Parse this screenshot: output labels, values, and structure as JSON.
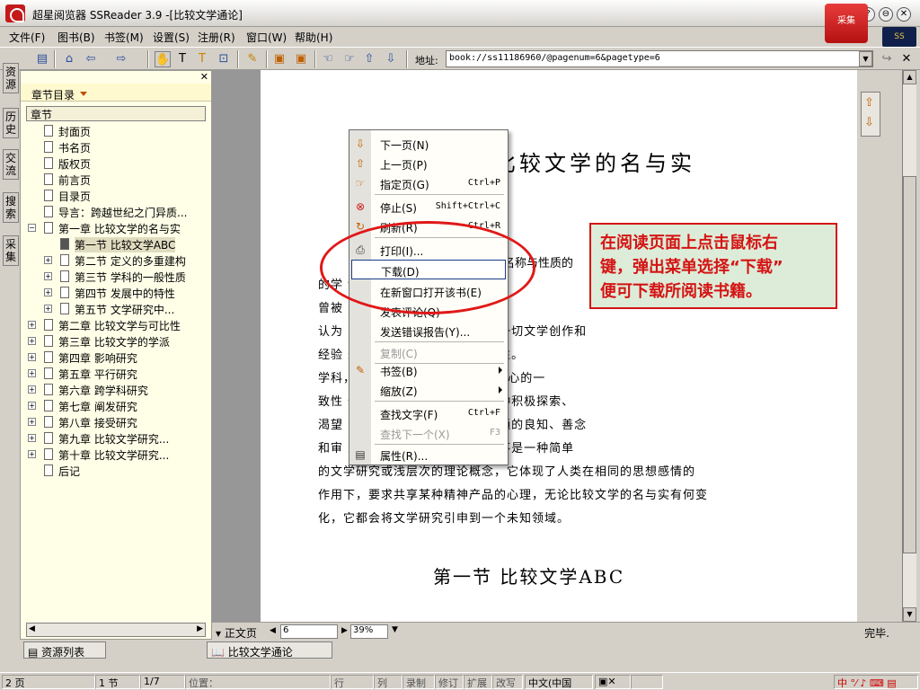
{
  "window": {
    "title": "超星阅览器 SSReader 3.9 -[比较文学通论]",
    "emblem": "采集"
  },
  "menu": [
    "文件(F)",
    "图书(B)",
    "书签(M)",
    "设置(S)",
    "注册(R)",
    "窗口(W)",
    "帮助(H)"
  ],
  "globe_logo": "SS",
  "toolbar": {
    "address_label": "地址:",
    "address_value": "book://ss11186960/@pagenum=6&pagetype=6"
  },
  "left_tabs": [
    "资源",
    "历史",
    "交流",
    "搜索",
    "采集"
  ],
  "sidebar": {
    "title": "章节目录",
    "column": "章节",
    "items": [
      {
        "label": "封面页",
        "level": 0,
        "expandable": false
      },
      {
        "label": "书名页",
        "level": 0,
        "expandable": false
      },
      {
        "label": "版权页",
        "level": 0,
        "expandable": false
      },
      {
        "label": "前言页",
        "level": 0,
        "expandable": false
      },
      {
        "label": "目录页",
        "level": 0,
        "expandable": false
      },
      {
        "label": "导言：跨越世纪之门异质...",
        "level": 0,
        "expandable": false
      },
      {
        "label": "第一章  比较文学的名与实",
        "level": 0,
        "expandable": true
      },
      {
        "label": "第一节  比较文学ABC",
        "level": 1,
        "expandable": false,
        "selected": true
      },
      {
        "label": "第二节  定义的多重建构",
        "level": 1,
        "expandable": true
      },
      {
        "label": "第三节  学科的一般性质",
        "level": 1,
        "expandable": true
      },
      {
        "label": "第四节  发展中的特性",
        "level": 1,
        "expandable": true
      },
      {
        "label": "第五节  文学研究中...",
        "level": 1,
        "expandable": true
      },
      {
        "label": "第二章  比较文学与可比性",
        "level": 0,
        "expandable": true
      },
      {
        "label": "第三章  比较文学的学派",
        "level": 0,
        "expandable": true
      },
      {
        "label": "第四章  影响研究",
        "level": 0,
        "expandable": true
      },
      {
        "label": "第五章  平行研究",
        "level": 0,
        "expandable": true
      },
      {
        "label": "第六章  跨学科研究",
        "level": 0,
        "expandable": true
      },
      {
        "label": "第七章  阐发研究",
        "level": 0,
        "expandable": true
      },
      {
        "label": "第八章  接受研究",
        "level": 0,
        "expandable": true
      },
      {
        "label": "第九章  比较文学研究...",
        "level": 0,
        "expandable": true
      },
      {
        "label": "第十章  比较文学研究...",
        "level": 0,
        "expandable": true
      },
      {
        "label": "后记",
        "level": 0,
        "expandable": false
      }
    ]
  },
  "page": {
    "heading": "比较文学的名与实",
    "lines": [
      "的学                                         论。比较文",
      "曾被                                         又指范围很广",
      "认为                                        角度来研究一切文学，认为一切文学创作和",
      "经验                                        这些认识都存在着某种片面性。",
      "                                             学科，重在研究中外的“人心”与文心的一",
      "致性                                         体的特殊性，都使人产生一种积极探索、",
      "渴望                                         动力。正是人类那些本质相通的良知、善念",
      "和审                                         成为可能。可是比较文学并不是一种简单",
      "的文学研究或浅层次的理论概念，它体现了人类在相同的思想感情的",
      "作用下，要求共享某种精神产品的心理，无论比较文学的名与实有何变",
      "化，它都会将文学研究引申到一个未知领域。"
    ],
    "right_fragment": "名称与性质的",
    "section_heading": "第一节    比较文学ABC"
  },
  "status_row": {
    "mode": "正文页",
    "page_input": "6",
    "zoom": "39%",
    "done": "完毕."
  },
  "bottom_tabs": [
    "资源列表",
    "比较文学通论"
  ],
  "statusbar": [
    "2 页",
    "1 节",
    "1/7",
    "位置：",
    "行",
    "列",
    "录制",
    "修订",
    "扩展",
    "改写",
    "中文(中国",
    "",
    "",
    ""
  ],
  "context_menu": [
    {
      "label": "下一页(N)",
      "shortcut": "",
      "icon": "down-arrow-icon",
      "glyph": "⇩"
    },
    {
      "label": "上一页(P)",
      "shortcut": "",
      "icon": "up-arrow-icon",
      "glyph": "⇧"
    },
    {
      "label": "指定页(G)",
      "shortcut": "Ctrl+P",
      "icon": "goto-page-icon",
      "glyph": "☞"
    },
    {
      "label": "停止(S)",
      "shortcut": "Shift+Ctrl+C",
      "icon": "stop-icon",
      "glyph": "⊗"
    },
    {
      "label": "刷新(R)",
      "shortcut": "Ctrl+R",
      "icon": "refresh-icon",
      "glyph": "↻"
    },
    {
      "label": "打印(I)...",
      "shortcut": "",
      "icon": "print-icon",
      "glyph": "⎙"
    },
    {
      "label": "下载(D)",
      "shortcut": "",
      "icon": "",
      "glyph": "",
      "highlight": true
    },
    {
      "label": "在新窗口打开该书(E)",
      "shortcut": "",
      "icon": "",
      "glyph": ""
    },
    {
      "label": "发表评论(Q)",
      "shortcut": "",
      "icon": "",
      "glyph": ""
    },
    {
      "label": "发送错误报告(Y)...",
      "shortcut": "",
      "icon": "",
      "glyph": ""
    },
    {
      "label": "复制(C)",
      "shortcut": "",
      "icon": "",
      "glyph": "",
      "disabled": true
    },
    {
      "label": "书签(B)",
      "shortcut": "",
      "icon": "bookmark-icon",
      "glyph": "✎",
      "submenu": true
    },
    {
      "label": "缩放(Z)",
      "shortcut": "",
      "icon": "",
      "glyph": "",
      "submenu": true
    },
    {
      "label": "查找文字(F)",
      "shortcut": "Ctrl+F",
      "icon": "",
      "glyph": ""
    },
    {
      "label": "查找下一个(X)",
      "shortcut": "F3",
      "icon": "",
      "glyph": "",
      "disabled": true
    },
    {
      "label": "属性(R)...",
      "shortcut": "",
      "icon": "properties-icon",
      "glyph": "▤"
    }
  ],
  "annotation": {
    "lines": [
      "在阅读页面上点击鼠标右",
      "键，弹出菜单选择“下载”",
      "便可下载所阅读书籍。"
    ],
    "color": "#d41414"
  }
}
